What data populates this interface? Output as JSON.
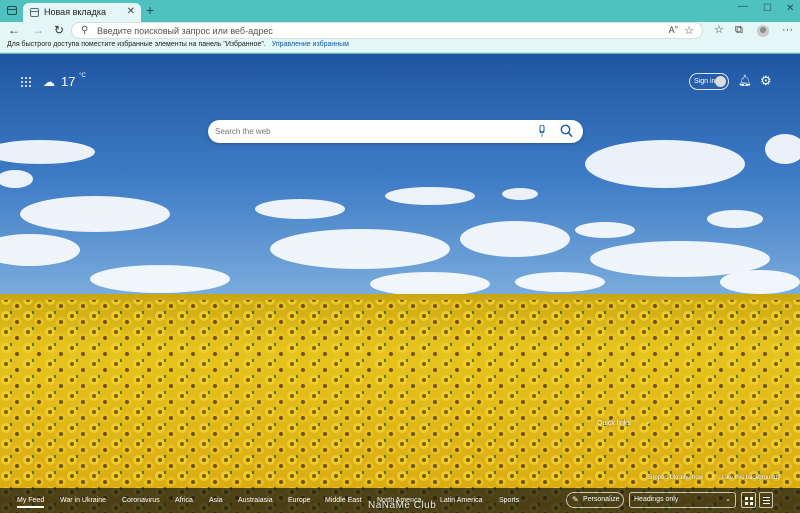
{
  "browser": {
    "tab_title": "Новая вкладка",
    "tab_close": "✕",
    "new_tab": "+",
    "window_controls": {
      "minimize": "—",
      "maximize": "☐",
      "close": "✕"
    }
  },
  "toolbar": {
    "address_placeholder": "Введите поисковый запрос или веб-адрес",
    "icons": [
      "back-icon",
      "forward-icon",
      "refresh-icon",
      "read-aloud-icon",
      "add-favorite-icon",
      "favorites-icon",
      "collections-icon",
      "extensions-icon",
      "profile-icon",
      "menu-icon"
    ]
  },
  "favorites_bar": {
    "text": "Для быстрого доступа поместите избранные элементы на панель \"Избранное\".",
    "link": "Управление избранным"
  },
  "newtab": {
    "weather": {
      "icon": "cloud-icon",
      "temperature": "17",
      "unit": "°C"
    },
    "signin_label": "Sign in",
    "search_placeholder": "Search the web",
    "quick_links": "Quick links",
    "support_text": "Support Ukraine now",
    "like_text": "Like this background?"
  },
  "feed": {
    "tabs": [
      "My Feed",
      "War in Ukraine",
      "Coronavirus",
      "Africa",
      "Asia",
      "Australasia",
      "Europe",
      "Middle East",
      "North America",
      "Latin America",
      "Sports"
    ],
    "active_tab": "My Feed",
    "personalize_label": "Personalize",
    "headings_label": "Headings only"
  },
  "watermark": "NaNaMe Club",
  "colors": {
    "chrome": "#4fc1be",
    "toolbar": "#e4f6f6",
    "sky": "#2f67b4",
    "sunflower": "#e8c214",
    "link": "#0b5cad"
  }
}
